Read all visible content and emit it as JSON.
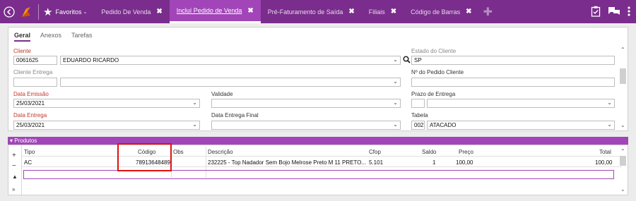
{
  "topbar": {
    "favorites_label": "Favoritos",
    "tabs": [
      {
        "label": "Pedido De Venda",
        "active": false
      },
      {
        "label": "Incluí Pedido de Venda",
        "active": true
      },
      {
        "label": "Pré-Faturamento de Saída",
        "active": false
      },
      {
        "label": "Filiais",
        "active": false
      },
      {
        "label": "Código de Barras",
        "active": false
      }
    ],
    "close_glyph": "✖",
    "add_glyph": "✚"
  },
  "form": {
    "tabs": [
      "Geral",
      "Anexos",
      "Tarefas"
    ],
    "cliente_label": "Cliente",
    "cliente_code": "0061625",
    "cliente_name": "EDUARDO RICARDO",
    "estado_label": "Estado do Cliente",
    "estado_value": "SP",
    "cliente_entrega_label": "Cliente Entrega",
    "num_pedido_cliente_label": "Nº do Pedido Cliente",
    "data_emissao_label": "Data Emissão",
    "data_emissao_value": "25/03/2021",
    "validade_label": "Validade",
    "prazo_entrega_label": "Prazo de Entrega",
    "data_entrega_label": "Data Entrega",
    "data_entrega_value": "25/03/2021",
    "data_entrega_final_label": "Data Entrega Final",
    "tabela_label": "Tabela",
    "tabela_code": "002",
    "tabela_name": "ATACADO"
  },
  "produtos": {
    "header": "Produtos",
    "columns": {
      "tipo": "Tipo",
      "codigo": "Código",
      "obs": "Obs",
      "descricao": "Descrição",
      "cfop": "Cfop",
      "saldo": "Saldo",
      "preco": "Preço",
      "total": "Total"
    },
    "row": {
      "tipo": "AC",
      "codigo": "78913648489",
      "obs": "",
      "descricao": "232225 - Top Nadador Sem Bojo Melrose Preto M 11 PRETO...",
      "cfop": "5.101",
      "saldo": "1",
      "preco": "100,00",
      "total": "100,00"
    }
  },
  "colors": {
    "brand": "#7a2d8c",
    "accent": "#a145b8",
    "required": "#c0392b",
    "highlight": "#e01010"
  }
}
